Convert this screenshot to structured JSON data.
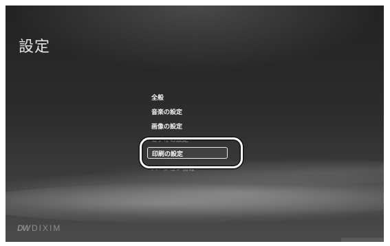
{
  "screen": {
    "title": "設定"
  },
  "menu": {
    "items": [
      {
        "label": "全般"
      },
      {
        "label": "音楽の設定"
      },
      {
        "label": "画像の設定"
      },
      {
        "label": "ビデオの設定"
      },
      {
        "label": "印刷の設定"
      },
      {
        "label": "バージョン情報"
      }
    ],
    "selected_index": 4
  },
  "logo": {
    "mark": "DW",
    "text": "DIXIM"
  },
  "colors": {
    "background": "#2a2a2a",
    "text": "#f2f2f2",
    "highlight": "#ffffff"
  }
}
